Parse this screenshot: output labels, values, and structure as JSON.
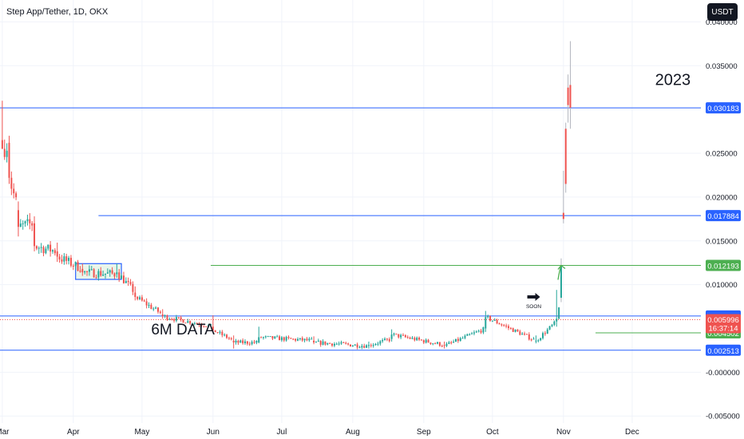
{
  "header": {
    "title": "Step App/Tether, 1D, OKX",
    "currency_button": "USDT"
  },
  "colors": {
    "up": "#26a69a",
    "down": "#ef5350",
    "blue_line": "#2962ff",
    "green_line": "#4caf50",
    "grid": "#f0f3fa",
    "axis_text": "#131722"
  },
  "chart_data": {
    "type": "candlestick",
    "title": "Step App/Tether, 1D, OKX",
    "xlabel": "",
    "ylabel": "",
    "ylim": [
      -0.0058,
      0.0425
    ],
    "grid": true,
    "x_tick_labels": [
      "Mar",
      "Apr",
      "May",
      "Jun",
      "Jul",
      "Aug",
      "Sep",
      "Oct",
      "Nov",
      "Dec"
    ],
    "x_tick_dates": [
      "2023-03-01",
      "2023-04-01",
      "2023-05-01",
      "2023-06-01",
      "2023-07-01",
      "2023-08-01",
      "2023-09-01",
      "2023-10-01",
      "2023-11-01",
      "2023-12-01"
    ],
    "y_ticks": [
      0.04,
      0.035,
      0.03,
      0.025,
      0.02,
      0.015,
      0.01,
      -0.0,
      -0.005
    ],
    "y_tick_labels": [
      "0.040000",
      "0.035000",
      "",
      "0.025000",
      "0.020000",
      "0.015000",
      "0.010000",
      "-0.000000",
      "-0.005000"
    ],
    "x_range": [
      "2023-02-28",
      "2023-12-31"
    ],
    "horizontal_lines": [
      {
        "value": 0.030183,
        "label": "0.030183",
        "color": "#2962ff",
        "from": "2023-02-28"
      },
      {
        "value": 0.017884,
        "label": "0.017884",
        "color": "#2962ff",
        "from": "2023-04-12"
      },
      {
        "value": 0.012193,
        "label": "0.012193",
        "color": "#4caf50",
        "from": "2023-05-31"
      },
      {
        "value": 0.006428,
        "label": "0.006428",
        "color": "#2962ff",
        "from": "2023-02-28"
      },
      {
        "value": 0.004502,
        "label": "0.004502",
        "color": "#4caf50",
        "from": "2023-11-15"
      },
      {
        "value": 0.002513,
        "label": "0.002513",
        "color": "#2962ff",
        "from": "2023-02-28"
      }
    ],
    "price_line": {
      "value": 0.005996,
      "label": "0.005996",
      "countdown": "16:37:14",
      "color": "#ef5350"
    },
    "annotations": {
      "year_label": "2023",
      "data_label": "6M DATA",
      "soon_label": "SOON"
    },
    "consolidation_box": {
      "from": "2023-04-02",
      "to": "2023-04-22",
      "low": 0.0106,
      "high": 0.0124
    },
    "key_candles": [
      {
        "date": "2023-03-01",
        "open": 0.0265,
        "high": 0.031,
        "low": 0.0255,
        "close": 0.0255
      },
      {
        "date": "2023-03-04",
        "open": 0.0262,
        "high": 0.027,
        "low": 0.0215,
        "close": 0.0222
      },
      {
        "date": "2023-03-08",
        "open": 0.0185,
        "high": 0.0195,
        "low": 0.0155,
        "close": 0.0166
      },
      {
        "date": "2023-03-15",
        "open": 0.017,
        "high": 0.0178,
        "low": 0.0138,
        "close": 0.0144
      },
      {
        "date": "2023-03-25",
        "open": 0.0138,
        "high": 0.0148,
        "low": 0.0126,
        "close": 0.0132
      },
      {
        "date": "2023-04-05",
        "open": 0.0118,
        "high": 0.0124,
        "low": 0.011,
        "close": 0.0114
      },
      {
        "date": "2023-04-20",
        "open": 0.0112,
        "high": 0.0124,
        "low": 0.0108,
        "close": 0.0114
      },
      {
        "date": "2023-04-28",
        "open": 0.0091,
        "high": 0.0098,
        "low": 0.0082,
        "close": 0.0086
      },
      {
        "date": "2023-05-10",
        "open": 0.0066,
        "high": 0.0072,
        "low": 0.0061,
        "close": 0.0064
      },
      {
        "date": "2023-06-01",
        "open": 0.0052,
        "high": 0.0065,
        "low": 0.0046,
        "close": 0.0048
      },
      {
        "date": "2023-06-10",
        "open": 0.0036,
        "high": 0.0042,
        "low": 0.0027,
        "close": 0.0034
      },
      {
        "date": "2023-06-21",
        "open": 0.0034,
        "high": 0.0052,
        "low": 0.0033,
        "close": 0.004
      },
      {
        "date": "2023-07-15",
        "open": 0.0036,
        "high": 0.0041,
        "low": 0.0032,
        "close": 0.0034
      },
      {
        "date": "2023-08-08",
        "open": 0.003,
        "high": 0.0035,
        "low": 0.0027,
        "close": 0.0031
      },
      {
        "date": "2023-08-18",
        "open": 0.0038,
        "high": 0.0049,
        "low": 0.0035,
        "close": 0.0043
      },
      {
        "date": "2023-09-10",
        "open": 0.0031,
        "high": 0.0035,
        "low": 0.0027,
        "close": 0.003
      },
      {
        "date": "2023-09-28",
        "open": 0.005,
        "high": 0.007,
        "low": 0.0046,
        "close": 0.0063
      },
      {
        "date": "2023-10-20",
        "open": 0.0036,
        "high": 0.0042,
        "low": 0.0033,
        "close": 0.0036
      },
      {
        "date": "2023-10-29",
        "open": 0.0058,
        "high": 0.0094,
        "low": 0.0052,
        "close": 0.0061
      },
      {
        "date": "2023-10-31",
        "open": 0.0085,
        "high": 0.013,
        "low": 0.008,
        "close": 0.0121
      },
      {
        "date": "2023-11-01",
        "open": 0.0182,
        "high": 0.023,
        "low": 0.017,
        "close": 0.0175
      },
      {
        "date": "2023-11-02",
        "open": 0.0278,
        "high": 0.0285,
        "low": 0.0205,
        "close": 0.0215
      },
      {
        "date": "2023-11-03",
        "open": 0.0325,
        "high": 0.034,
        "low": 0.0285,
        "close": 0.0305
      },
      {
        "date": "2023-11-04",
        "open": 0.0328,
        "high": 0.0378,
        "low": 0.0278,
        "close": 0.0302
      }
    ]
  }
}
